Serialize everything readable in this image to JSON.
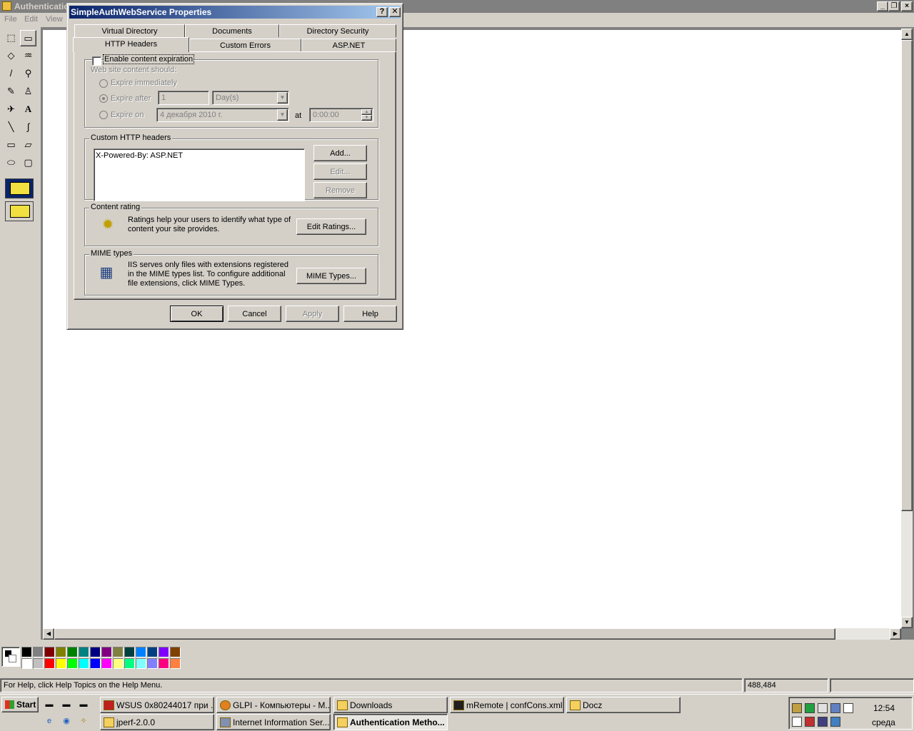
{
  "app": {
    "title": "Authentication Methods - Paint",
    "title_visible": "Authenticatio",
    "menu": [
      {
        "label": "File"
      },
      {
        "label": "Edit"
      },
      {
        "label": "View"
      }
    ],
    "status": {
      "help": "For Help, click Help Topics on the Help Menu.",
      "coords": "488,484"
    }
  },
  "dialog": {
    "title": "SimpleAuthWebService Properties",
    "help_btn": "?",
    "close_btn": "✕",
    "tabs_row1": [
      {
        "label": "Virtual Directory"
      },
      {
        "label": "Documents"
      },
      {
        "label": "Directory Security"
      }
    ],
    "tabs_row2": [
      {
        "label": "HTTP Headers"
      },
      {
        "label": "Custom Errors"
      },
      {
        "label": "ASP.NET"
      }
    ],
    "expiration": {
      "enable_label": "Enable content expiration",
      "should_label": "Web site content should:",
      "immediately": "Expire immediately",
      "after": "Expire after",
      "after_value": "1",
      "after_unit": "Day(s)",
      "on": "Expire on",
      "on_date": "4 декабря  2010 г.",
      "at": "at",
      "time": "0:00:00"
    },
    "custom_headers": {
      "label": "Custom HTTP headers",
      "items": [
        "X-Powered-By: ASP.NET"
      ],
      "add": "Add...",
      "edit": "Edit...",
      "remove": "Remove"
    },
    "content_rating": {
      "label": "Content rating",
      "text": "Ratings help your users to identify what type of content your site provides.",
      "button": "Edit Ratings..."
    },
    "mime": {
      "label": "MIME types",
      "text": "IIS serves only files with extensions registered in the MIME types list. To configure additional file extensions, click MIME Types.",
      "button": "MIME Types..."
    },
    "buttons": {
      "ok": "OK",
      "cancel": "Cancel",
      "apply": "Apply",
      "help": "Help"
    }
  },
  "palette": {
    "row1": [
      "#000000",
      "#808080",
      "#800000",
      "#808000",
      "#008000",
      "#008080",
      "#000080",
      "#800080",
      "#808040",
      "#004040",
      "#0080ff",
      "#004080",
      "#8000ff",
      "#804000"
    ],
    "row2": [
      "#ffffff",
      "#c0c0c0",
      "#ff0000",
      "#ffff00",
      "#00ff00",
      "#00ffff",
      "#0000ff",
      "#ff00ff",
      "#ffff80",
      "#00ff80",
      "#80ffff",
      "#8080ff",
      "#ff0080",
      "#ff8040"
    ]
  },
  "taskbar": {
    "start": "Start",
    "tasks": [
      {
        "label": "WSUS 0x80244017 при ...",
        "icon": "opera-icon"
      },
      {
        "label": "GLPI - Компьютеры - M...",
        "icon": "firefox-icon"
      },
      {
        "label": "Downloads",
        "icon": "folder-icon"
      },
      {
        "label": "mRemote | confCons.xml",
        "icon": "mremote-icon"
      },
      {
        "label": "Docz",
        "icon": "folder-icon"
      },
      {
        "label": "jperf-2.0.0",
        "icon": "folder-icon"
      },
      {
        "label": "Internet Information Ser...",
        "icon": "iis-icon"
      },
      {
        "label": "Authentication Metho...",
        "icon": "paint-icon"
      }
    ],
    "clock": "12:54",
    "day": "среда"
  }
}
